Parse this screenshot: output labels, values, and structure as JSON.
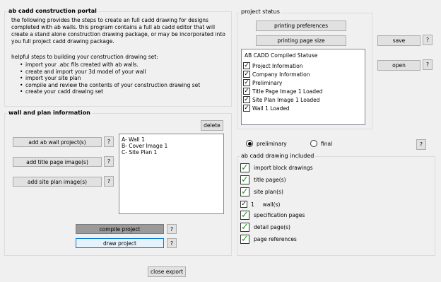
{
  "portal": {
    "title": "ab cadd construction portal",
    "description": "the following provides the steps to create an full cadd drawing for designs completed with ab walls. this program contains a full ab cadd editor that will create a stand alone construction drawing package, or may be incorporated into you full project cadd drawing package.",
    "steps_heading": "helpful steps to building your construction drawing set:",
    "steps": [
      "import your .abc fils created with ab walls.",
      "create and import your 3d model of your wall",
      "import your site plan",
      "compile and review the contents of your construction drawing set",
      "create your cadd drawing set"
    ]
  },
  "project_status": {
    "title": "project status",
    "printing_preferences_label": "printing preferences",
    "printing_page_size_label": "printing page size",
    "list_header": "AB CADD Compiled Statuse",
    "items": [
      {
        "label": "Project Information",
        "checked": true
      },
      {
        "label": "Company Information",
        "checked": true
      },
      {
        "label": "Preliminary",
        "checked": true
      },
      {
        "label": "Title Page Image 1 Loaded",
        "checked": true
      },
      {
        "label": "Site Plan Image 1 Loaded",
        "checked": true
      },
      {
        "label": "Wall 1 Loaded",
        "checked": true
      }
    ]
  },
  "side_buttons": {
    "save_label": "save",
    "open_label": "open",
    "help_label": "?"
  },
  "wall_plan": {
    "title": "wall and plan information",
    "delete_label": "delete",
    "add_wall_label": "add ab wall project(s)",
    "add_title_label": "add title page image(s)",
    "add_site_label": "add site plan image(s)",
    "help_label": "?",
    "list_items": [
      "A- Wall 1",
      "B- Cover Image 1",
      "C- Site Plan 1"
    ],
    "compile_label": "compile project",
    "draw_label": "draw project"
  },
  "mode": {
    "preliminary_label": "preliminary",
    "final_label": "final",
    "selected": "preliminary",
    "help_label": "?"
  },
  "included": {
    "title": "ab cadd drawing included",
    "items": [
      {
        "label": "import block drawings",
        "checked": true
      },
      {
        "label": "title page(s)",
        "checked": true
      },
      {
        "label": "site plan(s)",
        "checked": true
      },
      {
        "label": "wall(s)",
        "checked": true,
        "count": "1"
      },
      {
        "label": "specification pages",
        "checked": true
      },
      {
        "label": "detail page(s)",
        "checked": true
      },
      {
        "label": "page references",
        "checked": true
      }
    ]
  },
  "footer": {
    "close_export_label": "close export"
  }
}
